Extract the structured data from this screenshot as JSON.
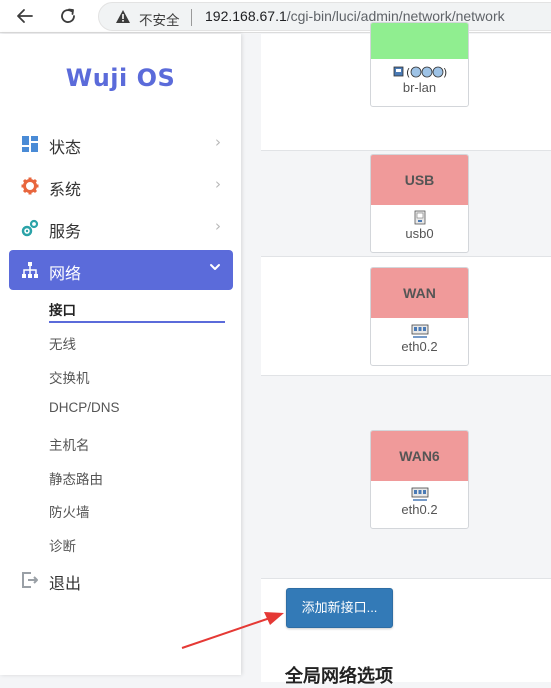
{
  "browser": {
    "back_icon": "arrow-left-icon",
    "reload_icon": "reload-icon",
    "insecure_label": "不安全",
    "url_host": "192.168.67.1",
    "url_path": "/cgi-bin/luci/admin/network/network"
  },
  "sidebar": {
    "logo": "Wuji OS",
    "menu": [
      {
        "label": "状态",
        "icon": "dashboard-icon"
      },
      {
        "label": "系统",
        "icon": "gear-icon"
      },
      {
        "label": "服务",
        "icon": "services-icon"
      },
      {
        "label": "网络",
        "icon": "network-icon"
      }
    ],
    "network_submenu": [
      "接口",
      "无线",
      "交换机",
      "DHCP/DNS",
      "主机名",
      "静态路由",
      "防火墙",
      "诊断"
    ],
    "logout": {
      "label": "退出",
      "icon": "logout-icon"
    },
    "accent_color": "#5b6bda"
  },
  "interfaces": [
    {
      "name": "",
      "device": "br-lan",
      "header_color": "#90ee90",
      "device_icon": "bridge-icon"
    },
    {
      "name": "USB",
      "device": "usb0",
      "header_color": "#f09a9a",
      "device_icon": "usb-device-icon"
    },
    {
      "name": "WAN",
      "device": "eth0.2",
      "header_color": "#f09a9a",
      "device_icon": "ethernet-port-icon"
    },
    {
      "name": "WAN6",
      "device": "eth0.2",
      "header_color": "#f09a9a",
      "device_icon": "ethernet-port-icon"
    }
  ],
  "actions": {
    "add_interface": "添加新接口..."
  },
  "global_options": {
    "title": "全局网络选项"
  }
}
